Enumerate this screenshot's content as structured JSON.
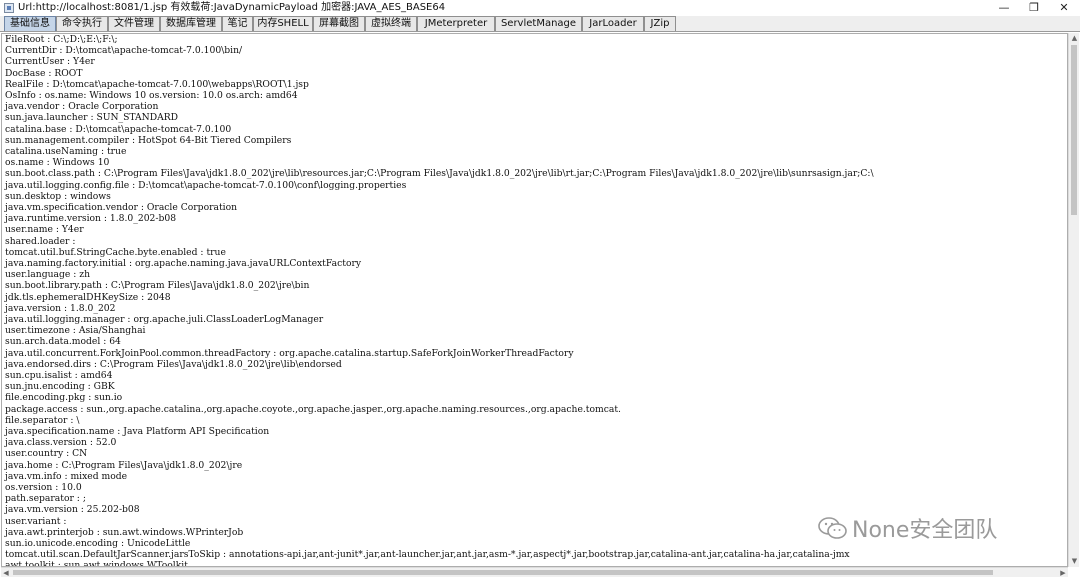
{
  "window": {
    "title": "Url:http://localhost:8081/1.jsp 有效载荷:JavaDynamicPayload 加密器:JAVA_AES_BASE64",
    "minimize_glyph": "—",
    "maximize_glyph": "❐",
    "close_glyph": "✕"
  },
  "tabs": [
    {
      "label": "基础信息",
      "active": true
    },
    {
      "label": "命令执行"
    },
    {
      "label": "文件管理"
    },
    {
      "label": "数据库管理"
    },
    {
      "label": "笔记"
    },
    {
      "label": "内存SHELL"
    },
    {
      "label": "屏幕截图"
    },
    {
      "label": "虚拟终端"
    },
    {
      "label": "JMeterpreter"
    },
    {
      "label": "ServletManage"
    },
    {
      "label": "JarLoader"
    },
    {
      "label": "JZip"
    }
  ],
  "info_lines": [
    "FileRoot : C:\\;D:\\;E:\\;F:\\;",
    "CurrentDir : D:\\tomcat\\apache-tomcat-7.0.100\\bin/",
    "CurrentUser : Y4er",
    "DocBase : ROOT",
    "RealFile : D:\\tomcat\\apache-tomcat-7.0.100\\webapps\\ROOT\\1.jsp",
    "OsInfo : os.name: Windows 10 os.version: 10.0 os.arch: amd64",
    "java.vendor : Oracle Corporation",
    "sun.java.launcher : SUN_STANDARD",
    "catalina.base : D:\\tomcat\\apache-tomcat-7.0.100",
    "sun.management.compiler : HotSpot 64-Bit Tiered Compilers",
    "catalina.useNaming : true",
    "os.name : Windows 10",
    "sun.boot.class.path : C:\\Program Files\\Java\\jdk1.8.0_202\\jre\\lib\\resources.jar;C:\\Program Files\\Java\\jdk1.8.0_202\\jre\\lib\\rt.jar;C:\\Program Files\\Java\\jdk1.8.0_202\\jre\\lib\\sunrsasign.jar;C:\\",
    "java.util.logging.config.file : D:\\tomcat\\apache-tomcat-7.0.100\\conf\\logging.properties",
    "sun.desktop : windows",
    "java.vm.specification.vendor : Oracle Corporation",
    "java.runtime.version : 1.8.0_202-b08",
    "user.name : Y4er",
    "shared.loader :",
    "tomcat.util.buf.StringCache.byte.enabled : true",
    "java.naming.factory.initial : org.apache.naming.java.javaURLContextFactory",
    "user.language : zh",
    "sun.boot.library.path : C:\\Program Files\\Java\\jdk1.8.0_202\\jre\\bin",
    "jdk.tls.ephemeralDHKeySize : 2048",
    "java.version : 1.8.0_202",
    "java.util.logging.manager : org.apache.juli.ClassLoaderLogManager",
    "user.timezone : Asia/Shanghai",
    "sun.arch.data.model : 64",
    "java.util.concurrent.ForkJoinPool.common.threadFactory : org.apache.catalina.startup.SafeForkJoinWorkerThreadFactory",
    "java.endorsed.dirs : C:\\Program Files\\Java\\jdk1.8.0_202\\jre\\lib\\endorsed",
    "sun.cpu.isalist : amd64",
    "sun.jnu.encoding : GBK",
    "file.encoding.pkg : sun.io",
    "package.access : sun.,org.apache.catalina.,org.apache.coyote.,org.apache.jasper.,org.apache.naming.resources.,org.apache.tomcat.",
    "file.separator : \\",
    "java.specification.name : Java Platform API Specification",
    "java.class.version : 52.0",
    "user.country : CN",
    "java.home : C:\\Program Files\\Java\\jdk1.8.0_202\\jre",
    "java.vm.info : mixed mode",
    "os.version : 10.0",
    "path.separator : ;",
    "java.vm.version : 25.202-b08",
    "user.variant :",
    "java.awt.printerjob : sun.awt.windows.WPrinterJob",
    "sun.io.unicode.encoding : UnicodeLittle",
    "tomcat.util.scan.DefaultJarScanner.jarsToSkip : annotations-api.jar,ant-junit*.jar,ant-launcher.jar,ant.jar,asm-*.jar,aspectj*.jar,bootstrap.jar,catalina-ant.jar,catalina-ha.jar,catalina-jmx",
    "awt.toolkit : sun.awt.windows.WToolkit"
  ],
  "watermark": {
    "text": "None安全团队",
    "icon": "wechat-icon"
  },
  "colors": {
    "active_tab": "#c5d5e8",
    "tab_background": "#e8e8e8",
    "watermark": "#9a9a9a"
  }
}
